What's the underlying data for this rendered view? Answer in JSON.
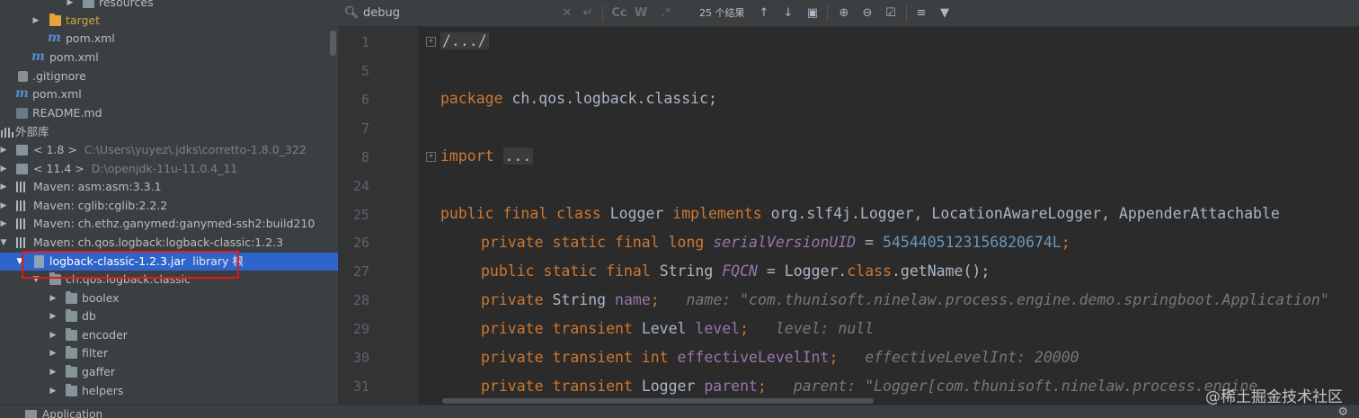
{
  "project_tree": {
    "rows": [
      {
        "text": "resources",
        "icon": "folder-icon",
        "sub": ""
      },
      {
        "text": "target",
        "icon": "folder-orange-icon",
        "sub": ""
      },
      {
        "text": "pom.xml",
        "icon": "maven-icon",
        "sub": ""
      },
      {
        "text": "pom.xml",
        "icon": "maven-icon",
        "sub": ""
      },
      {
        "text": ".gitignore",
        "icon": "gitignore-icon",
        "sub": ""
      },
      {
        "text": "pom.xml",
        "icon": "maven-icon",
        "sub": ""
      },
      {
        "text": "README.md",
        "icon": "markdown-icon",
        "sub": ""
      },
      {
        "text": "外部库",
        "icon": "library-icon",
        "sub": ""
      },
      {
        "text": "< 1.8 >",
        "icon": "jdk-icon",
        "sub": "C:\\Users\\yuyez\\.jdks\\corretto-1.8.0_322"
      },
      {
        "text": "< 11.4 >",
        "icon": "jdk-icon",
        "sub": "D:\\openjdk-11u-11.0.4_11"
      },
      {
        "text": "Maven: asm:asm:3.3.1",
        "icon": "library-bars-icon",
        "sub": ""
      },
      {
        "text": "Maven: cglib:cglib:2.2.2",
        "icon": "library-bars-icon",
        "sub": ""
      },
      {
        "text": "Maven: ch.ethz.ganymed:ganymed-ssh2:build210",
        "icon": "library-bars-icon",
        "sub": ""
      },
      {
        "text": "Maven: ch.qos.logback:logback-classic:1.2.3",
        "icon": "library-bars-icon",
        "sub": ""
      },
      {
        "text": "logback-classic-1.2.3.jar",
        "icon": "jar-icon",
        "sub": "library 根"
      },
      {
        "text": "ch.qos.logback.classic",
        "icon": "package-icon",
        "sub": ""
      },
      {
        "text": "boolex",
        "icon": "folder-icon",
        "sub": ""
      },
      {
        "text": "db",
        "icon": "folder-icon",
        "sub": ""
      },
      {
        "text": "encoder",
        "icon": "folder-icon",
        "sub": ""
      },
      {
        "text": "filter",
        "icon": "folder-icon",
        "sub": ""
      },
      {
        "text": "gaffer",
        "icon": "folder-icon",
        "sub": ""
      },
      {
        "text": "helpers",
        "icon": "folder-icon",
        "sub": ""
      }
    ]
  },
  "search": {
    "query": "debug",
    "result_count": "25 个结果",
    "match_case_label": "Cc",
    "words_label": "W",
    "regex_label": ".*"
  },
  "editor": {
    "lines": [
      {
        "no": "1"
      },
      {
        "no": "5"
      },
      {
        "no": "6"
      },
      {
        "no": "7"
      },
      {
        "no": "8"
      },
      {
        "no": "24"
      },
      {
        "no": "25"
      },
      {
        "no": "26"
      },
      {
        "no": "27"
      },
      {
        "no": "28"
      },
      {
        "no": "29"
      },
      {
        "no": "30"
      },
      {
        "no": "31"
      }
    ],
    "fold_header": "/.../",
    "package_kw": "package",
    "package_name": " ch.qos.logback.classic;",
    "import_kw": "import",
    "import_fold": "...",
    "class_decl": {
      "kw1": "public final class ",
      "name": "Logger ",
      "kw2": "implements ",
      "rest": "org.slf4j.Logger, LocationAwareLogger, AppenderAttachable"
    },
    "l26": {
      "kw": "private static final long ",
      "field": "serialVersionUID",
      "eq": " = ",
      "num": "5454405123156820674L",
      "end": ";"
    },
    "l27": {
      "kw": "public static final ",
      "type": "String ",
      "field": "FQCN",
      "eq": " = Logger.",
      "kw2": "class",
      "rest": ".getName();"
    },
    "l28": {
      "kw": "private ",
      "type": "String ",
      "field": "name",
      "end": ";",
      "hint": "name: \"com.thunisoft.ninelaw.process.engine.demo.springboot.Application\""
    },
    "l29": {
      "kw": "private transient ",
      "type": "Level ",
      "field": "level",
      "end": ";",
      "hint": "level: null"
    },
    "l30": {
      "kw": "private transient int ",
      "field": "effectiveLevelInt",
      "end": ";",
      "hint": "effectiveLevelInt: 20000"
    },
    "l31": {
      "kw": "private transient ",
      "type": "Logger ",
      "field": "parent",
      "end": ";",
      "hint": "parent: \"Logger[com.thunisoft.ninelaw.process.engine"
    }
  },
  "bottom_bar": {
    "app_label": "Application"
  },
  "watermark": "@稀土掘金技术社区",
  "colors": {
    "selection": "#2f65ca",
    "highlight_box": "#e0191c",
    "keyword": "#cc7832",
    "field": "#9876aa",
    "number": "#6897bb"
  }
}
